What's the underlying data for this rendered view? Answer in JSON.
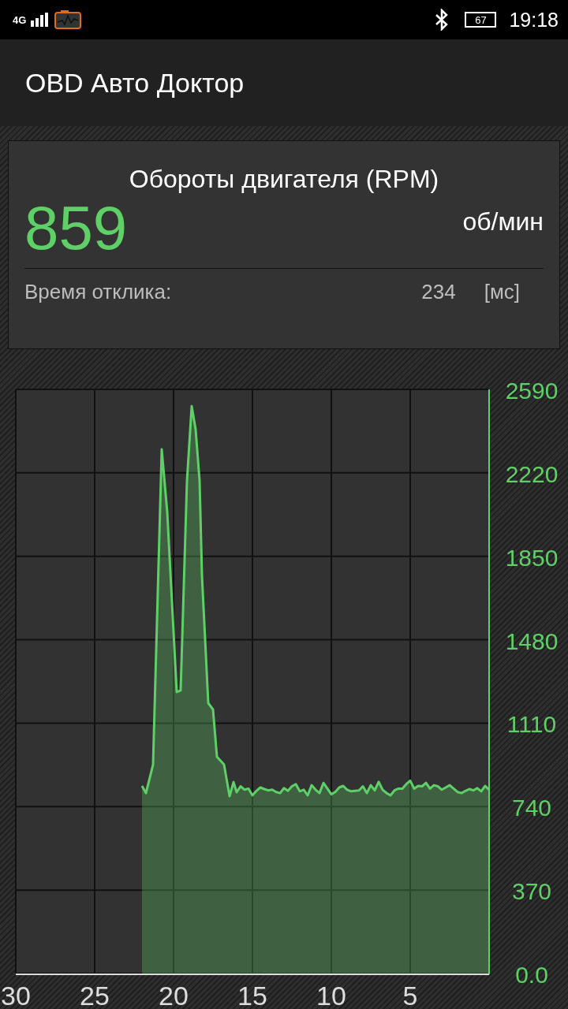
{
  "status_bar": {
    "network": "4G",
    "battery": "67",
    "time": "19:18"
  },
  "app_bar": {
    "title": "OBD Авто Доктор"
  },
  "sensor_card": {
    "title": "Обороты двигателя (RPM)",
    "value": "859",
    "unit": "об/мин",
    "response_label": "Время отклика:",
    "response_value": "234",
    "response_unit": "[мс]"
  },
  "chart": {
    "chart_data": {
      "type": "area",
      "x": [
        22,
        21.75,
        21.3,
        20.75,
        20.4,
        19.8,
        19.55,
        19.15,
        18.85,
        18.6,
        18.35,
        18.2,
        17.8,
        17.5,
        17.25,
        16.8,
        16.45,
        16.2,
        16,
        15.75,
        15.5,
        15.25,
        15,
        14.75,
        14.5,
        14.25,
        14,
        13.75,
        13.5,
        13.25,
        13,
        12.75,
        12.5,
        12.25,
        12,
        11.75,
        11.5,
        11.25,
        11,
        10.75,
        10.5,
        10.25,
        10,
        9.75,
        9.5,
        9.25,
        9,
        8.75,
        8.5,
        8.25,
        8,
        7.75,
        7.5,
        7.25,
        7,
        6.75,
        6.5,
        6.25,
        6,
        5.75,
        5.5,
        5.25,
        5,
        4.75,
        4.5,
        4.25,
        4,
        3.75,
        3.5,
        3.25,
        3,
        2.75,
        2.5,
        2.25,
        2,
        1.75,
        1.5,
        1.25,
        1,
        0.75,
        0.5,
        0.25,
        0
      ],
      "grid": true,
      "series": [
        {
          "color": "#5fd068",
          "values": [
            832,
            800,
            926,
            2324,
            2045,
            1248,
            1255,
            2184,
            2516,
            2412,
            2184,
            1765,
            1199,
            1171,
            961,
            926,
            786,
            849,
            804,
            830,
            815,
            820,
            790,
            810,
            825,
            818,
            812,
            815,
            805,
            800,
            822,
            810,
            830,
            840,
            808,
            815,
            790,
            835,
            815,
            800,
            845,
            820,
            795,
            805,
            825,
            832,
            815,
            808,
            810,
            812,
            830,
            800,
            835,
            812,
            850,
            815,
            800,
            790,
            812,
            820,
            820,
            840,
            855,
            820,
            832,
            830,
            845,
            820,
            835,
            830,
            815,
            825,
            835,
            820,
            805,
            800,
            810,
            818,
            812,
            822,
            808,
            832,
            815
          ]
        }
      ],
      "xlim": [
        30,
        0
      ],
      "ylim": [
        0,
        2590
      ],
      "xticks": [
        30,
        25,
        20,
        15,
        10,
        5
      ],
      "yticks": [
        {
          "value": 0,
          "label": "0.0"
        },
        370,
        740,
        1110,
        1480,
        1850,
        2220,
        2590
      ]
    }
  }
}
